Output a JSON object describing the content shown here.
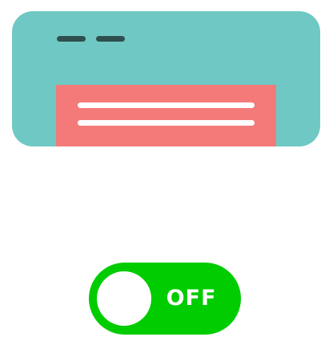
{
  "colors": {
    "unit_body": "#6fc8c3",
    "unit_dashes": "#2f4f4f",
    "vent": "#f47a7a",
    "vent_lines": "#ffffff",
    "toggle_bg": "#00cc00",
    "toggle_knob": "#ffffff",
    "toggle_text": "#ffffff"
  },
  "toggle": {
    "label": "OFF",
    "state": "off"
  },
  "icons": {
    "unit": "air-conditioner-icon"
  }
}
